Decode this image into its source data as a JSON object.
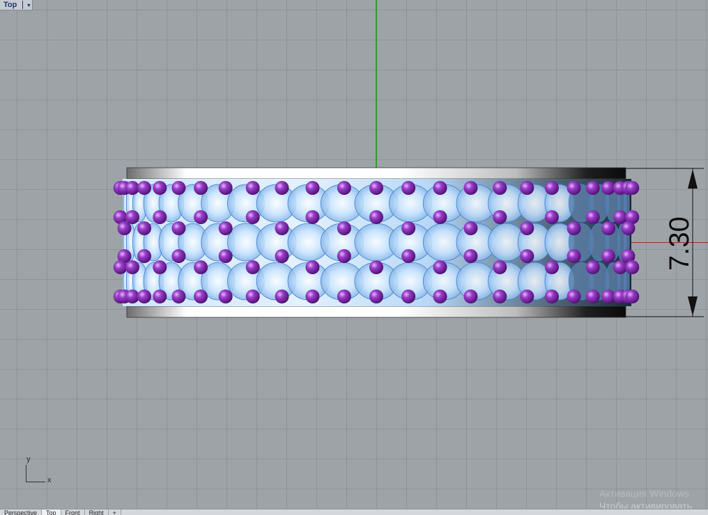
{
  "viewport": {
    "view_label": "Top",
    "view_menu_icon": "triangle-down-icon",
    "dimension_value": "7.30",
    "cplane_axis_y": "y",
    "cplane_axis_x": "x",
    "axis_colors": {
      "y": "#2e9a2e",
      "x": "#b02323"
    },
    "gem_color": "#7c2fa3",
    "stone_color": "#a9d4ff"
  },
  "viewport_tabs": [
    "Perspective",
    "Top",
    "Front",
    "Right",
    "+"
  ],
  "windows_activation": {
    "line1": "Активация Windows",
    "line2": "Чтобы активировать Windows"
  }
}
